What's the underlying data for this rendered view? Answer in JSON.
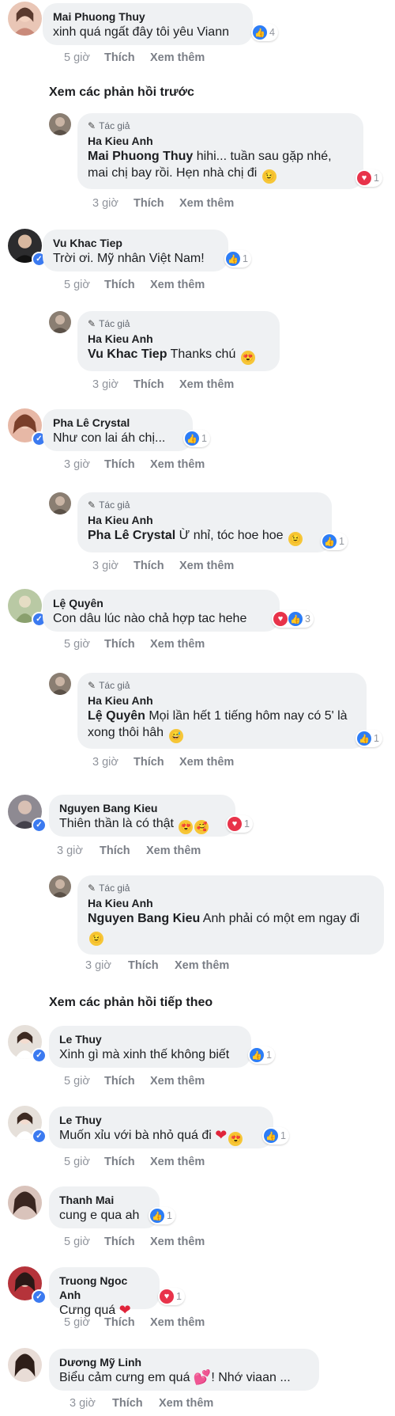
{
  "actions": {
    "like": "Thích",
    "more": "Xem thêm"
  },
  "author_tag": "Tác giả",
  "sections": {
    "prev": "Xem các phản hồi trước",
    "next": "Xem các phản hồi tiếp theo"
  },
  "comments": [
    {
      "author": "Mai Phuong Thuy",
      "text": "xinh quá ngất đây tôi yêu Viann",
      "time": "5 giờ",
      "reaction_count": "4"
    },
    {
      "author": "Ha Kieu Anh",
      "mention": "Mai Phuong Thuy",
      "text": " hihi... tuần sau gặp nhé, mai chị bay rồi. Hẹn nhà chị đi",
      "time": "3 giờ",
      "reaction_count": "1"
    },
    {
      "author": "Vu Khac Tiep",
      "text": "Trời ơi. Mỹ nhân Việt Nam!",
      "time": "5 giờ",
      "reaction_count": "1"
    },
    {
      "author": "Ha Kieu Anh",
      "mention": "Vu Khac Tiep",
      "text": " Thanks chú",
      "time": "3 giờ"
    },
    {
      "author": "Pha Lê Crystal",
      "text": "Như con lai áh chị...",
      "time": "3 giờ",
      "reaction_count": "1"
    },
    {
      "author": "Ha Kieu Anh",
      "mention": "Pha Lê Crystal",
      "text": " Ừ nhỉ, tóc hoe hoe",
      "time": "3 giờ",
      "reaction_count": "1"
    },
    {
      "author": "Lệ Quyên",
      "text": "Con dâu lúc nào chả hợp tac hehe",
      "time": "5 giờ",
      "reaction_count": "3"
    },
    {
      "author": "Ha Kieu Anh",
      "mention": "Lệ Quyên",
      "text": " Mọi lần hết 1 tiếng hôm nay có 5' là xong thôi hâh",
      "time": "3 giờ",
      "reaction_count": "1"
    },
    {
      "author": "Nguyen Bang Kieu",
      "text": "Thiên thần là có thật",
      "time": "3 giờ",
      "reaction_count": "1"
    },
    {
      "author": "Ha Kieu Anh",
      "mention": "Nguyen Bang Kieu",
      "text": " Anh phải có một em ngay đi",
      "time": "3 giờ"
    },
    {
      "author": "Le Thuy",
      "text": "Xinh gì mà xinh thế không biết",
      "time": "5 giờ",
      "reaction_count": "1"
    },
    {
      "author": "Le Thuy",
      "text": "Muốn xỉu với bà nhỏ quá đi",
      "time": "5 giờ",
      "reaction_count": "1"
    },
    {
      "author": "Thanh Mai",
      "text": "cung e qua ah",
      "time": "5 giờ",
      "reaction_count": "1"
    },
    {
      "author": "Truong Ngoc Anh",
      "text": "Cưng quá",
      "time": "5 giờ",
      "reaction_count": "1"
    },
    {
      "author": "Dương Mỹ Linh",
      "text": "Biểu cảm cưng em quá",
      "text2": "! Nhớ viaan ...",
      "time": "3 giờ"
    }
  ]
}
